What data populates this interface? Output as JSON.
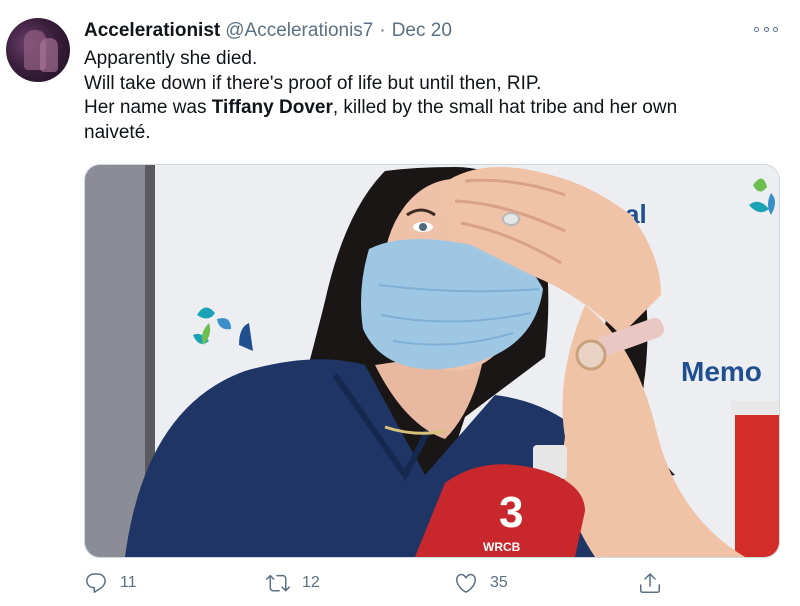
{
  "tweet": {
    "author": {
      "display_name": "Accelerationist",
      "handle": "@Accelerationis7",
      "avatar_icon": "avatar-icon"
    },
    "separator": "·",
    "date": "Dec 20",
    "text_lines": [
      "Apparently she died.",
      "Will take down if there's proof of life but until then, RIP.",
      "Her name was ",
      "Tiffany Dover",
      ", killed by the small hat tribe and her own",
      "naiveté."
    ],
    "media": {
      "background_texts": [
        "al",
        "Memo",
        "WRCB",
        "3"
      ]
    },
    "actions": {
      "reply_count": "11",
      "retweet_count": "12",
      "like_count": "35"
    },
    "colors": {
      "secondary_text": "#5b7083",
      "primary_text": "#0f1419",
      "border": "#cfd9de",
      "scrubs": "#1f3566",
      "mask": "#9ec7e3",
      "news_mic": "#c8282b",
      "logo_teal": "#1aa3b7"
    }
  }
}
